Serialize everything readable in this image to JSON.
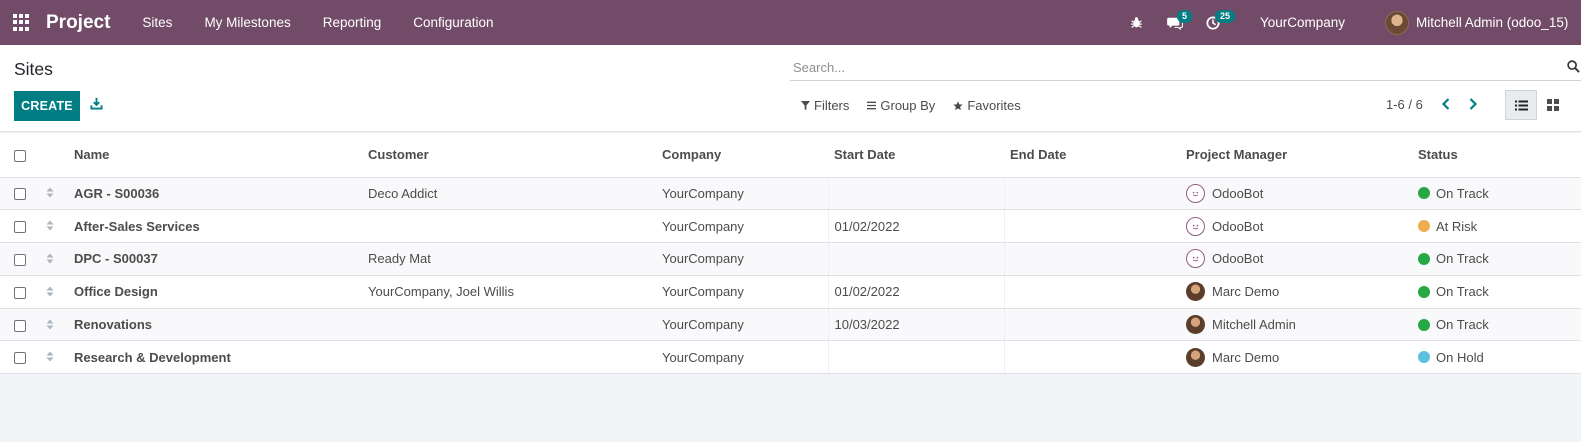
{
  "navbar": {
    "app_name": "Project",
    "menu": [
      "Sites",
      "My Milestones",
      "Reporting",
      "Configuration"
    ],
    "messages_count": "5",
    "activities_count": "25",
    "company": "YourCompany",
    "user": "Mitchell Admin (odoo_15)"
  },
  "control": {
    "title": "Sites",
    "create_label": "CREATE",
    "search_placeholder": "Search...",
    "filters_label": "Filters",
    "groupby_label": "Group By",
    "favorites_label": "Favorites",
    "pager": "1-6 / 6"
  },
  "table": {
    "headers": [
      "Name",
      "Customer",
      "Company",
      "Start Date",
      "End Date",
      "Project Manager",
      "Status"
    ],
    "rows": [
      {
        "name": "AGR - S00036",
        "customer": "Deco Addict",
        "company": "YourCompany",
        "start": "",
        "end": "",
        "manager": "OdooBot",
        "manager_type": "bot",
        "status": "On Track",
        "status_color": "#28a745"
      },
      {
        "name": "After-Sales Services",
        "customer": "",
        "company": "YourCompany",
        "start": "01/02/2022",
        "end": "",
        "manager": "OdooBot",
        "manager_type": "bot",
        "status": "At Risk",
        "status_color": "#f0ad4e"
      },
      {
        "name": "DPC - S00037",
        "customer": "Ready Mat",
        "company": "YourCompany",
        "start": "",
        "end": "",
        "manager": "OdooBot",
        "manager_type": "bot",
        "status": "On Track",
        "status_color": "#28a745"
      },
      {
        "name": "Office Design",
        "customer": "YourCompany, Joel Willis",
        "company": "YourCompany",
        "start": "01/02/2022",
        "end": "",
        "manager": "Marc Demo",
        "manager_type": "photo",
        "status": "On Track",
        "status_color": "#28a745"
      },
      {
        "name": "Renovations",
        "customer": "",
        "company": "YourCompany",
        "start": "10/03/2022",
        "end": "",
        "manager": "Mitchell Admin",
        "manager_type": "photo",
        "status": "On Track",
        "status_color": "#28a745"
      },
      {
        "name": "Research & Development",
        "customer": "",
        "company": "YourCompany",
        "start": "",
        "end": "",
        "manager": "Marc Demo",
        "manager_type": "photo",
        "status": "On Hold",
        "status_color": "#5bc0de"
      }
    ]
  },
  "colors": {
    "brand": "#714b67",
    "primary": "#017e84"
  }
}
